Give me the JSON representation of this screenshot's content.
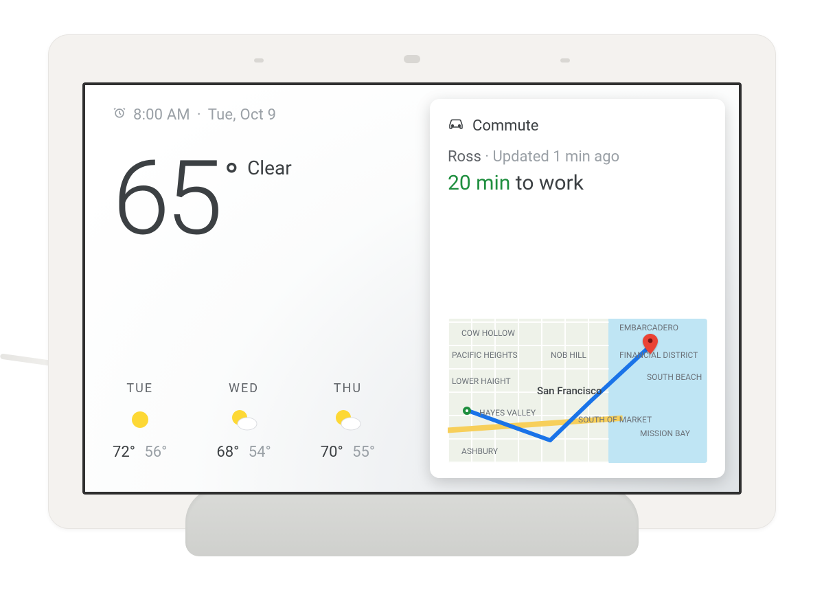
{
  "status": {
    "alarm_time": "8:00 AM",
    "date": "Tue, Oct 9",
    "separator": "·"
  },
  "weather": {
    "current_temp": "65",
    "degree_symbol": "°",
    "condition": "Clear",
    "forecast": [
      {
        "day": "TUE",
        "icon": "sunny",
        "hi": "72°",
        "lo": "56°"
      },
      {
        "day": "WED",
        "icon": "partly-cloudy",
        "hi": "68°",
        "lo": "54°"
      },
      {
        "day": "THU",
        "icon": "partly-cloudy",
        "hi": "70°",
        "lo": "55°"
      }
    ]
  },
  "commute": {
    "header": "Commute",
    "name": "Ross",
    "updated": "Updated 1 min ago",
    "eta": "20 min",
    "destination_phrase": "to work",
    "map": {
      "city_label": "San Francisco",
      "neighborhoods": [
        "COW HOLLOW",
        "EMBARCADERO",
        "PACIFIC HEIGHTS",
        "NOB HILL",
        "FINANCIAL DISTRICT",
        "LOWER HAIGHT",
        "SOUTH BEACH",
        "HAYES VALLEY",
        "SOUTH OF MARKET",
        "MISSION BAY",
        "ASHBURY"
      ]
    }
  }
}
